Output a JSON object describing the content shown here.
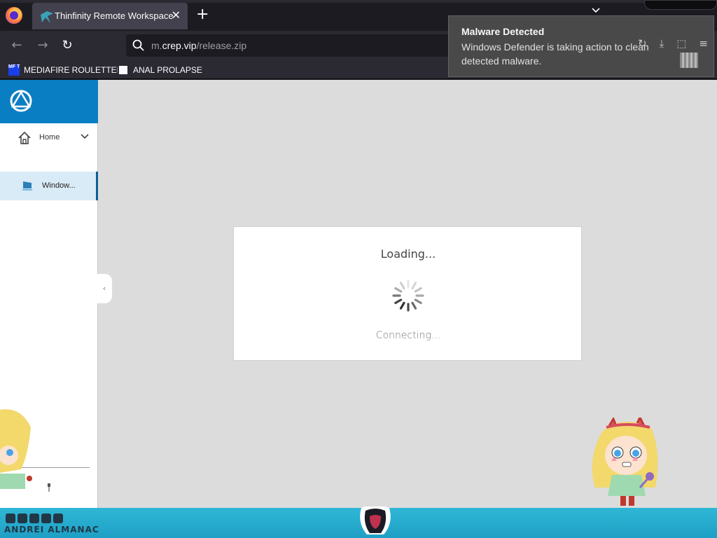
{
  "browser": {
    "tab": {
      "title": "Thinfinity Remote Workspace",
      "close_glyph": "✕"
    },
    "new_tab_glyph": "+",
    "nav": {
      "back_glyph": "←",
      "forward_glyph": "→",
      "reload_glyph": "↻"
    },
    "url": {
      "prefix": "m.",
      "domain": "crep.vip",
      "path": "/release.zip"
    },
    "bookmarks": [
      {
        "label": "MEDIAFIRE ROULETTER",
        "icon": "mediafire-icon",
        "icon_text": "MF T"
      },
      {
        "label": "ANAL PROLAPSE",
        "icon": "terminal-icon"
      }
    ]
  },
  "toast": {
    "title": "Malware Detected",
    "body": "Windows Defender is taking action to clean detected malware.",
    "icons": [
      "arrow-icon",
      "download-icon",
      "extensions-icon",
      "menu-icon"
    ]
  },
  "app": {
    "sidebar": {
      "home_label": "Home",
      "active_item_label": "Window...",
      "collapse_glyph": "‹"
    },
    "dialog": {
      "title": "Loading...",
      "status": "Connecting..."
    }
  },
  "watermark": {
    "text": "ANDREI ALMANAC"
  },
  "colors": {
    "accent_blue": "#0a7ec2",
    "selected_item": "#d9ebf6",
    "toast_bg": "#4b4b4b",
    "bottom_strip": "#2fb7d6"
  }
}
